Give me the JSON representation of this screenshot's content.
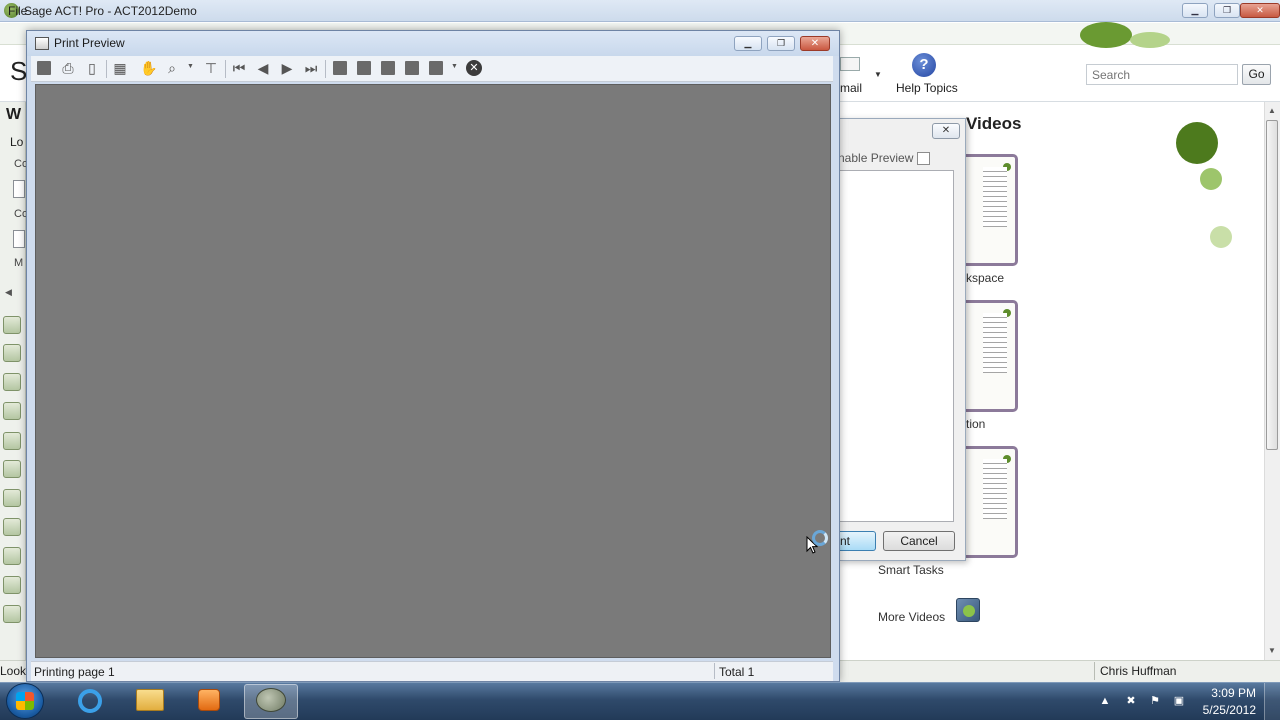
{
  "app": {
    "title": "Sage ACT! Pro - ACT2012Demo",
    "menu_file": "File",
    "big_letter": "S",
    "workspace_letter": "W",
    "lookup_label": "Lo",
    "left_labels": [
      "Co",
      "Co",
      "M"
    ],
    "toolbar_email_label": "mail",
    "toolbar_help_label": "Help Topics",
    "search_placeholder": "Search",
    "go_label": "Go",
    "status_left": "Look",
    "status_user": "Chris Huffman"
  },
  "content": {
    "title": "Featured Videos",
    "title_visible": "Videos",
    "thumbnails": [
      {
        "label": "kspace"
      },
      {
        "label": "tion"
      },
      {
        "label": "Smart Tasks"
      }
    ],
    "more_videos": "More Videos"
  },
  "print_dialog": {
    "enable_preview_label": "nable Preview",
    "print_button": "nt",
    "cancel_button": "Cancel",
    "close_symbol": "✕"
  },
  "print_preview": {
    "title": "Print Preview",
    "status_text": "Printing page 1",
    "total_text": "Total 1",
    "minimize_symbol": "▁",
    "maximize_symbol": "❐",
    "close_symbol": "✕"
  },
  "taskbar": {
    "time": "3:09 PM",
    "date": "5/25/2012"
  }
}
